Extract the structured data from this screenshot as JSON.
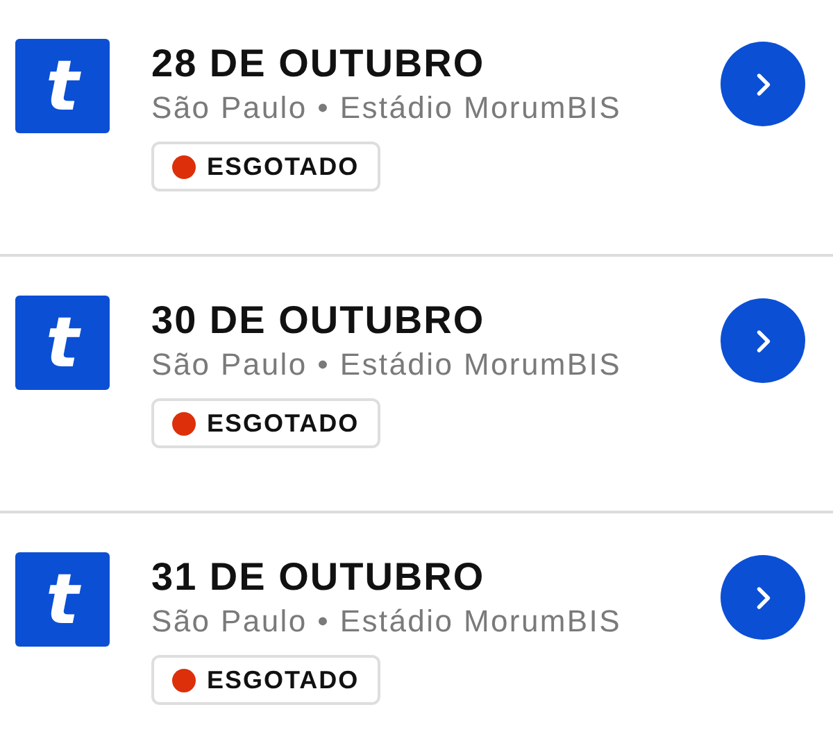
{
  "events": [
    {
      "logo": "t",
      "date": "28 DE OUTUBRO",
      "city": "São Paulo",
      "separator": "•",
      "venue": "Estádio MorumBIS",
      "status": "ESGOTADO",
      "color": "#dc2f0a"
    },
    {
      "logo": "t",
      "date": "30 DE OUTUBRO",
      "city": "São Paulo",
      "separator": "•",
      "venue": "Estádio MorumBIS",
      "status": "ESGOTADO",
      "color": "#dc2f0a"
    },
    {
      "logo": "t",
      "date": "31 DE OUTUBRO",
      "city": "São Paulo",
      "separator": "•",
      "venue": "Estádio MorumBIS",
      "status": "ESGOTADO",
      "color": "#dc2f0a"
    }
  ]
}
